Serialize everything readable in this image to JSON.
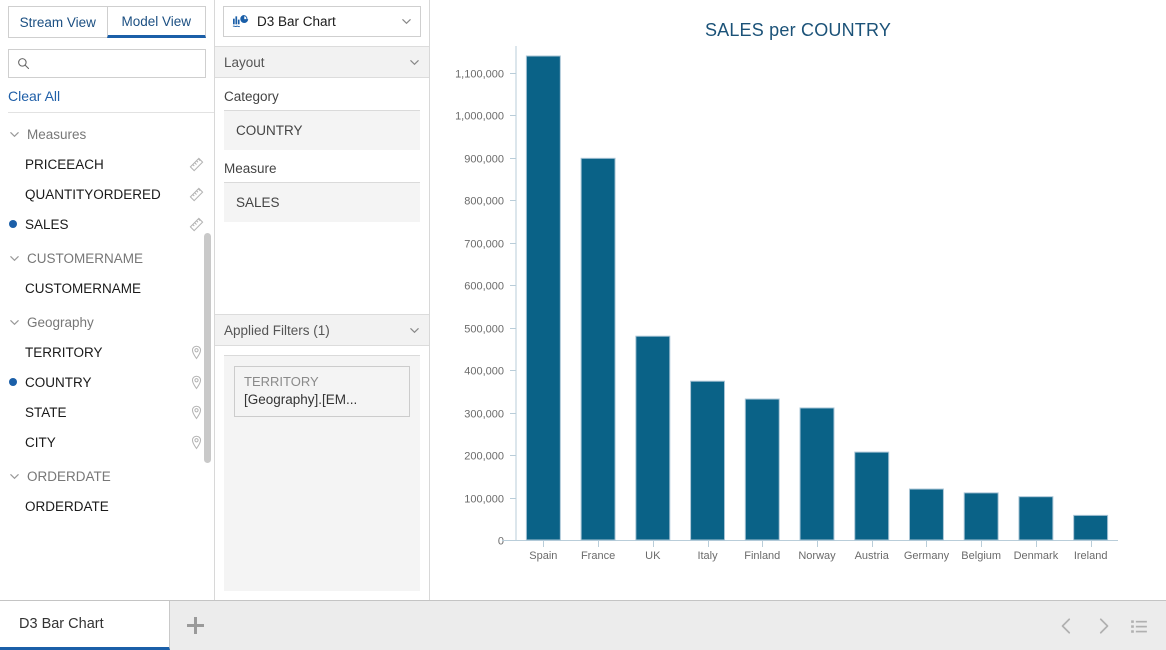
{
  "left_panel": {
    "view_tabs": [
      {
        "label": "Stream View",
        "active": false
      },
      {
        "label": "Model View",
        "active": true
      }
    ],
    "search": {
      "value": "",
      "placeholder": "",
      "icon": "search-icon"
    },
    "clear_all_label": "Clear All",
    "groups": [
      {
        "name": "Measures",
        "expanded_icon": "chevron-down-icon",
        "items": [
          {
            "label": "PRICEEACH",
            "selected": false,
            "icon": "ruler-icon"
          },
          {
            "label": "QUANTITYORDERED",
            "selected": false,
            "icon": "ruler-icon"
          },
          {
            "label": "SALES",
            "selected": true,
            "icon": "ruler-icon"
          }
        ]
      },
      {
        "name": "CUSTOMERNAME",
        "expanded_icon": "chevron-down-icon",
        "items": [
          {
            "label": "CUSTOMERNAME",
            "selected": false,
            "icon": ""
          }
        ]
      },
      {
        "name": "Geography",
        "expanded_icon": "chevron-down-icon",
        "items": [
          {
            "label": "TERRITORY",
            "selected": false,
            "icon": "location-pin-icon"
          },
          {
            "label": "COUNTRY",
            "selected": true,
            "icon": "location-pin-icon"
          },
          {
            "label": "STATE",
            "selected": false,
            "icon": "location-pin-icon"
          },
          {
            "label": "CITY",
            "selected": false,
            "icon": "location-pin-icon"
          }
        ]
      },
      {
        "name": "ORDERDATE",
        "expanded_icon": "chevron-down-icon",
        "items": [
          {
            "label": "ORDERDATE",
            "selected": false,
            "icon": ""
          }
        ]
      }
    ]
  },
  "middle_panel": {
    "chart_selector": {
      "value": "D3 Bar Chart",
      "icon": "chart-type-icon",
      "caret": "chevron-down-icon"
    },
    "layout_section": {
      "title": "Layout",
      "caret": "chevron-down-icon",
      "category_label": "Category",
      "category_value": "COUNTRY",
      "measure_label": "Measure",
      "measure_value": "SALES"
    },
    "filters_section": {
      "title": "Applied Filters (1)",
      "caret": "chevron-down-icon",
      "filters": [
        {
          "field": "TERRITORY",
          "value": "[Geography].[EM..."
        }
      ]
    }
  },
  "chart_data": {
    "type": "bar",
    "title": "SALES per COUNTRY",
    "xlabel": "",
    "ylabel": "",
    "categories": [
      "Spain",
      "France",
      "UK",
      "Italy",
      "Finland",
      "Norway",
      "Austria",
      "Germany",
      "Belgium",
      "Denmark",
      "Ireland"
    ],
    "values": [
      1140000,
      899000,
      480000,
      374000,
      332000,
      311000,
      207000,
      120000,
      111000,
      102000,
      58000
    ],
    "ylim": [
      0,
      1140000
    ],
    "yticks": [
      0,
      100000,
      200000,
      300000,
      400000,
      500000,
      600000,
      700000,
      800000,
      900000,
      1000000,
      1100000
    ],
    "ytick_labels": [
      "0",
      "100,000",
      "200,000",
      "300,000",
      "400,000",
      "500,000",
      "600,000",
      "700,000",
      "800,000",
      "900,000",
      "1,000,000",
      "1,100,000"
    ],
    "grid": false,
    "legend": false,
    "bar_color": "#0a6287",
    "bar_stroke": "#a9c5d6",
    "axis_color": "#b9cdd9",
    "title_color": "#1b5278"
  },
  "tabstrip": {
    "document_tab": "D3 Bar Chart",
    "add_tab_icon": "plus-icon",
    "tools": [
      {
        "icon": "chevron-left-icon",
        "name": "prev-tab-button"
      },
      {
        "icon": "chevron-right-icon",
        "name": "next-tab-button"
      },
      {
        "icon": "list-icon",
        "name": "tab-list-button"
      }
    ]
  }
}
